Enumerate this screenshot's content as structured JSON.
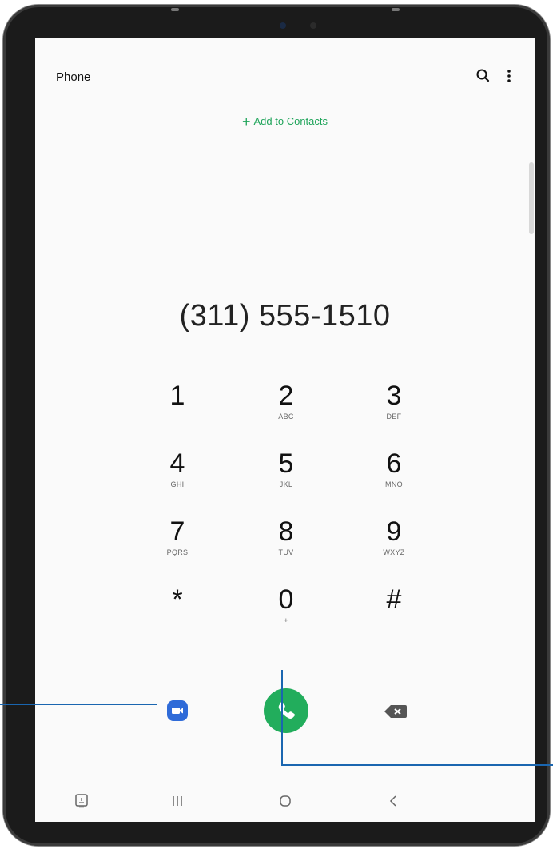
{
  "header": {
    "title": "Phone",
    "search_icon": "search-icon",
    "more_icon": "more-options-icon"
  },
  "add_contacts": {
    "plus": "+",
    "label": "Add to Contacts"
  },
  "dialer": {
    "number": "(311) 555-1510",
    "keys": [
      {
        "digit": "1",
        "letters": ""
      },
      {
        "digit": "2",
        "letters": "ABC"
      },
      {
        "digit": "3",
        "letters": "DEF"
      },
      {
        "digit": "4",
        "letters": "GHI"
      },
      {
        "digit": "5",
        "letters": "JKL"
      },
      {
        "digit": "6",
        "letters": "MNO"
      },
      {
        "digit": "7",
        "letters": "PQRS"
      },
      {
        "digit": "8",
        "letters": "TUV"
      },
      {
        "digit": "9",
        "letters": "WXYZ"
      },
      {
        "digit": "*",
        "letters": ""
      },
      {
        "digit": "0",
        "letters": "+"
      },
      {
        "digit": "#",
        "letters": ""
      }
    ]
  },
  "actions": {
    "video_call_icon": "video-camera-icon",
    "call_icon": "phone-icon",
    "backspace_icon": "backspace-icon"
  },
  "navbar": {
    "items": [
      "screenshot-icon",
      "recent-apps-icon",
      "home-icon",
      "back-icon"
    ]
  },
  "colors": {
    "accent_green": "#22ad5c",
    "video_blue": "#2f6bd8",
    "callout_blue": "#1a66b0"
  }
}
